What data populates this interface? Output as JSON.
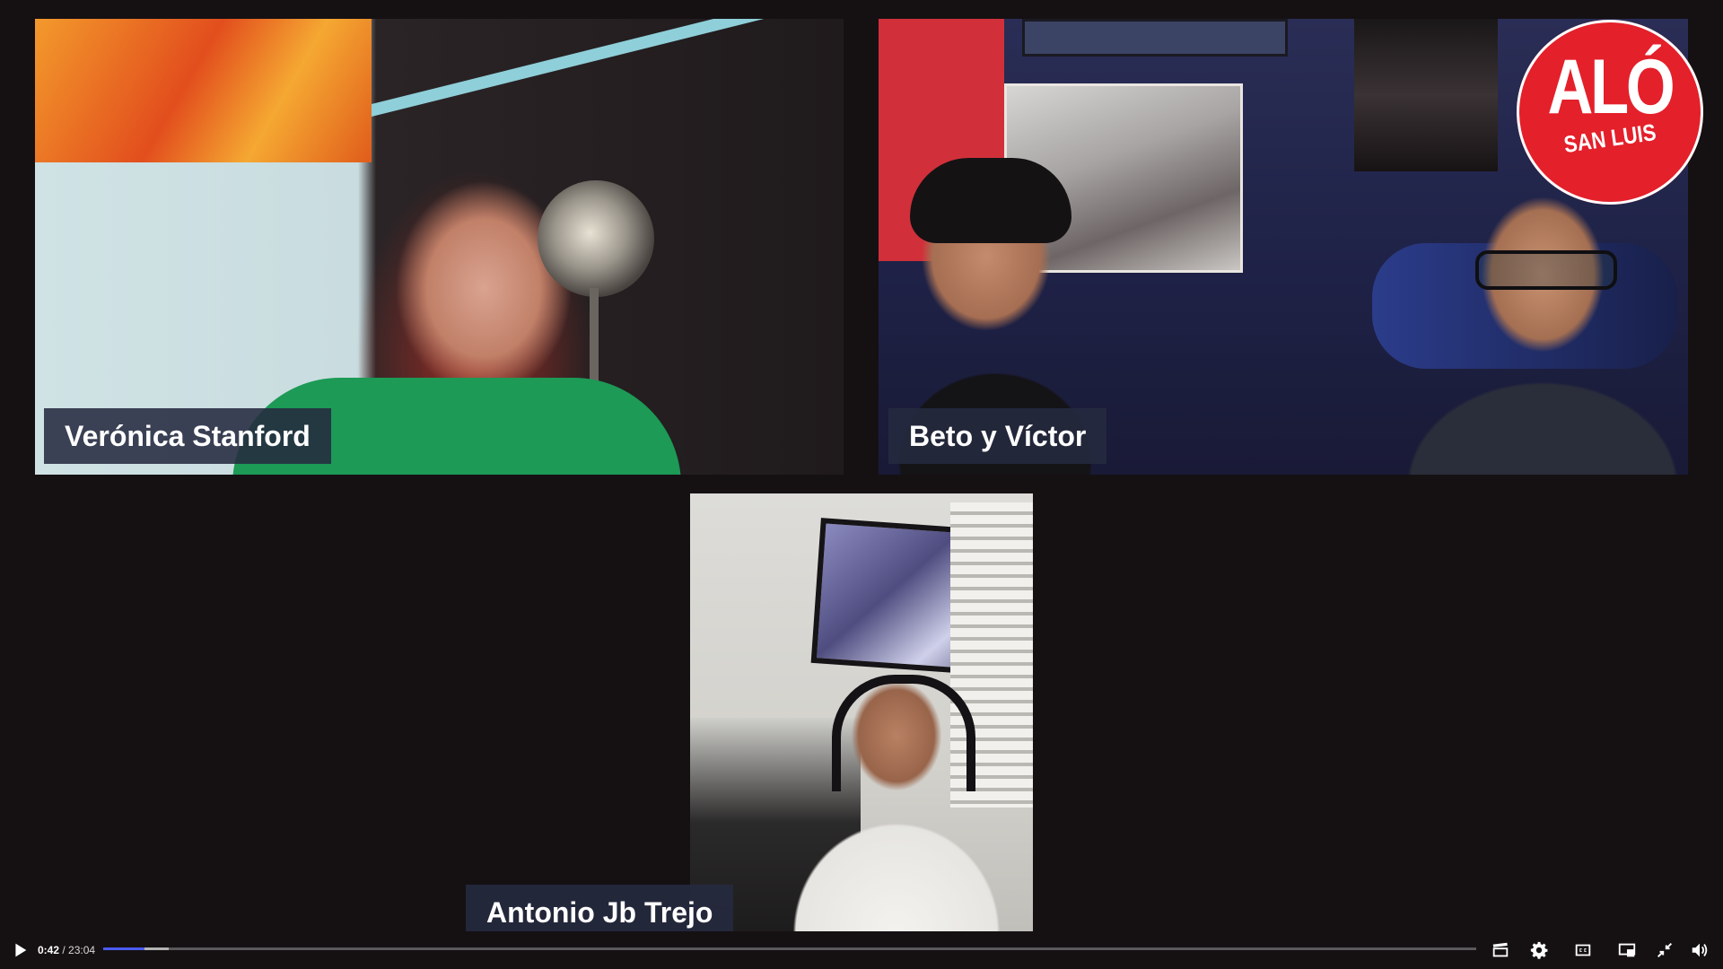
{
  "participants": [
    {
      "name": "Verónica Stanford"
    },
    {
      "name": "Beto y Víctor"
    },
    {
      "name": "Antonio Jb Trejo"
    }
  ],
  "logo": {
    "main_text": "ALÓ",
    "sub_text": "SAN LUIS",
    "color": "#e4202b"
  },
  "player": {
    "current_time": "0:42",
    "separator": " / ",
    "duration": "23:04",
    "progress_fraction": 0.0303,
    "buffered_fraction": 0.048,
    "progress_color": "#4a5cf0",
    "controls": {
      "play": "play-icon",
      "clip": "clapperboard-icon",
      "settings": "gear-icon",
      "captions": "cc-icon",
      "miniplayer": "miniplayer-icon",
      "exit_fullscreen": "exit-fullscreen-icon",
      "volume": "volume-icon"
    }
  }
}
